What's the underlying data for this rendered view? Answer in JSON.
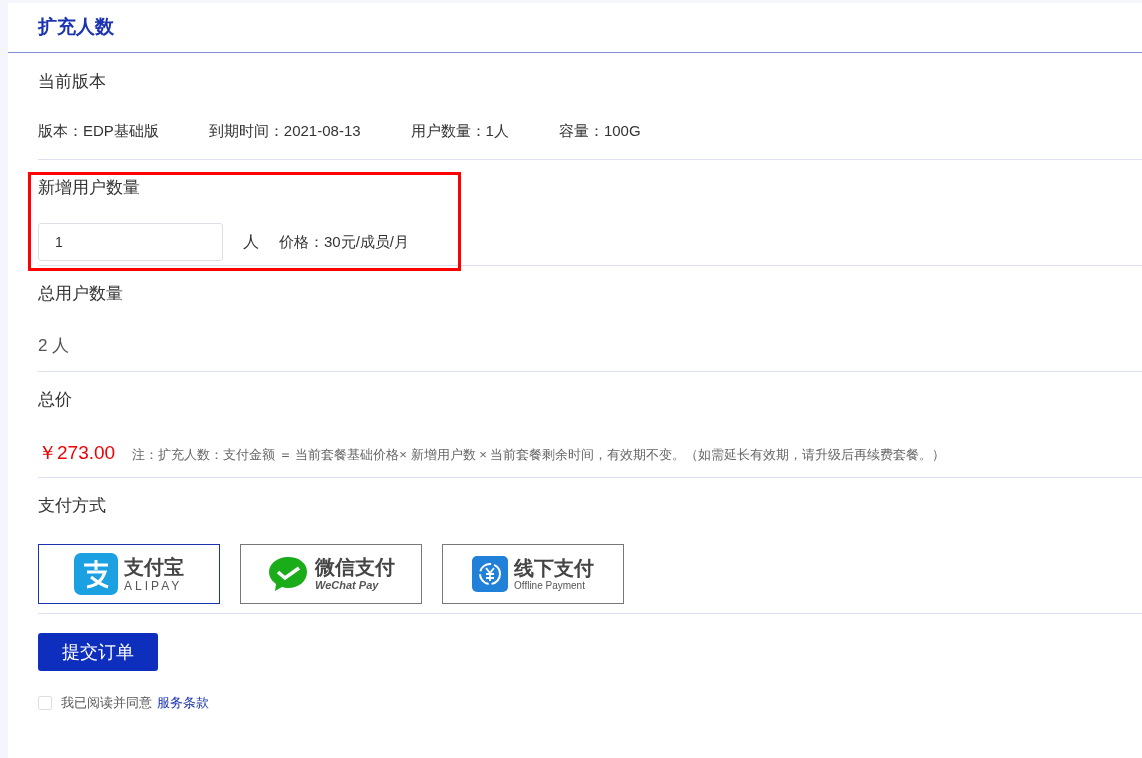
{
  "title": "扩充人数",
  "current_version": {
    "heading": "当前版本",
    "items": [
      "版本：EDP基础版",
      "到期时间：2021-08-13",
      "用户数量：1人",
      "容量：100G"
    ]
  },
  "new_users": {
    "heading": "新增用户数量",
    "highlighted": true,
    "value": "1",
    "unit": "人",
    "price": "价格：30元/成员/月"
  },
  "total_users": {
    "heading": "总用户数量",
    "value": "2 人"
  },
  "total_price": {
    "heading": "总价",
    "amount": "￥273.00",
    "note": "注：扩充人数：支付金额 ＝ 当前套餐基础价格× 新增用户数 × 当前套餐剩余时间，有效期不变。（如需延长有效期，请升级后再续费套餐。）"
  },
  "payment": {
    "heading": "支付方式",
    "options": [
      {
        "kind": "alipay",
        "title": "支付宝",
        "subtitle": "ALIPAY",
        "selected": true
      },
      {
        "kind": "wechat",
        "title": "微信支付",
        "subtitle": "WeChat Pay",
        "selected": false
      },
      {
        "kind": "offline",
        "title": "线下支付",
        "subtitle": "Offline Payment",
        "selected": false
      }
    ]
  },
  "submit": "提交订单",
  "agreement": {
    "checked": false,
    "text": "我已阅读并同意",
    "link": "服务条款"
  }
}
